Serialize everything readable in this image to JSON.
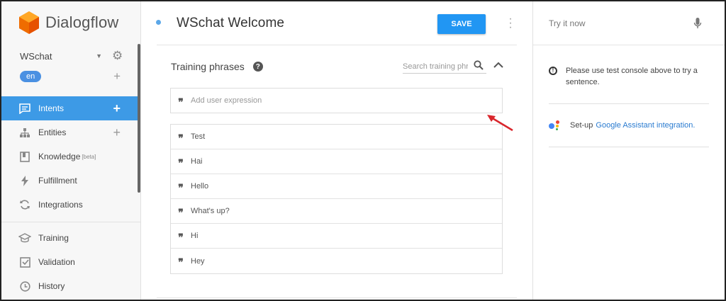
{
  "app": {
    "name": "Dialogflow"
  },
  "agent": {
    "name": "WSchat",
    "language": "en"
  },
  "nav": [
    {
      "label": "Intents",
      "icon": "chat-bubble-icon",
      "plus": true,
      "active": true
    },
    {
      "label": "Entities",
      "icon": "sitemap-icon",
      "plus": true
    },
    {
      "label": "Knowledge",
      "badge": "[beta]",
      "icon": "book-icon"
    },
    {
      "label": "Fulfillment",
      "icon": "bolt-icon"
    },
    {
      "label": "Integrations",
      "icon": "sync-icon"
    },
    {
      "label": "Training",
      "icon": "graduation-cap-icon"
    },
    {
      "label": "Validation",
      "icon": "checkbox-icon"
    },
    {
      "label": "History",
      "icon": "clock-icon"
    }
  ],
  "intent": {
    "title": "WSchat Welcome",
    "save_label": "SAVE"
  },
  "training": {
    "title": "Training phrases",
    "search_placeholder": "Search training phrases",
    "add_placeholder": "Add user expression",
    "phrases": [
      "Test",
      "Hai",
      "Hello",
      "What's up?",
      "Hi",
      "Hey"
    ]
  },
  "console": {
    "try_placeholder": "Try it now",
    "notice": "Please use test console above to try a sentence.",
    "setup_prefix": "Set-up",
    "setup_link": "Google Assistant integration."
  },
  "colors": {
    "accent": "#3d9ae6",
    "save": "#2196f3",
    "arrow": "#d9262c"
  }
}
